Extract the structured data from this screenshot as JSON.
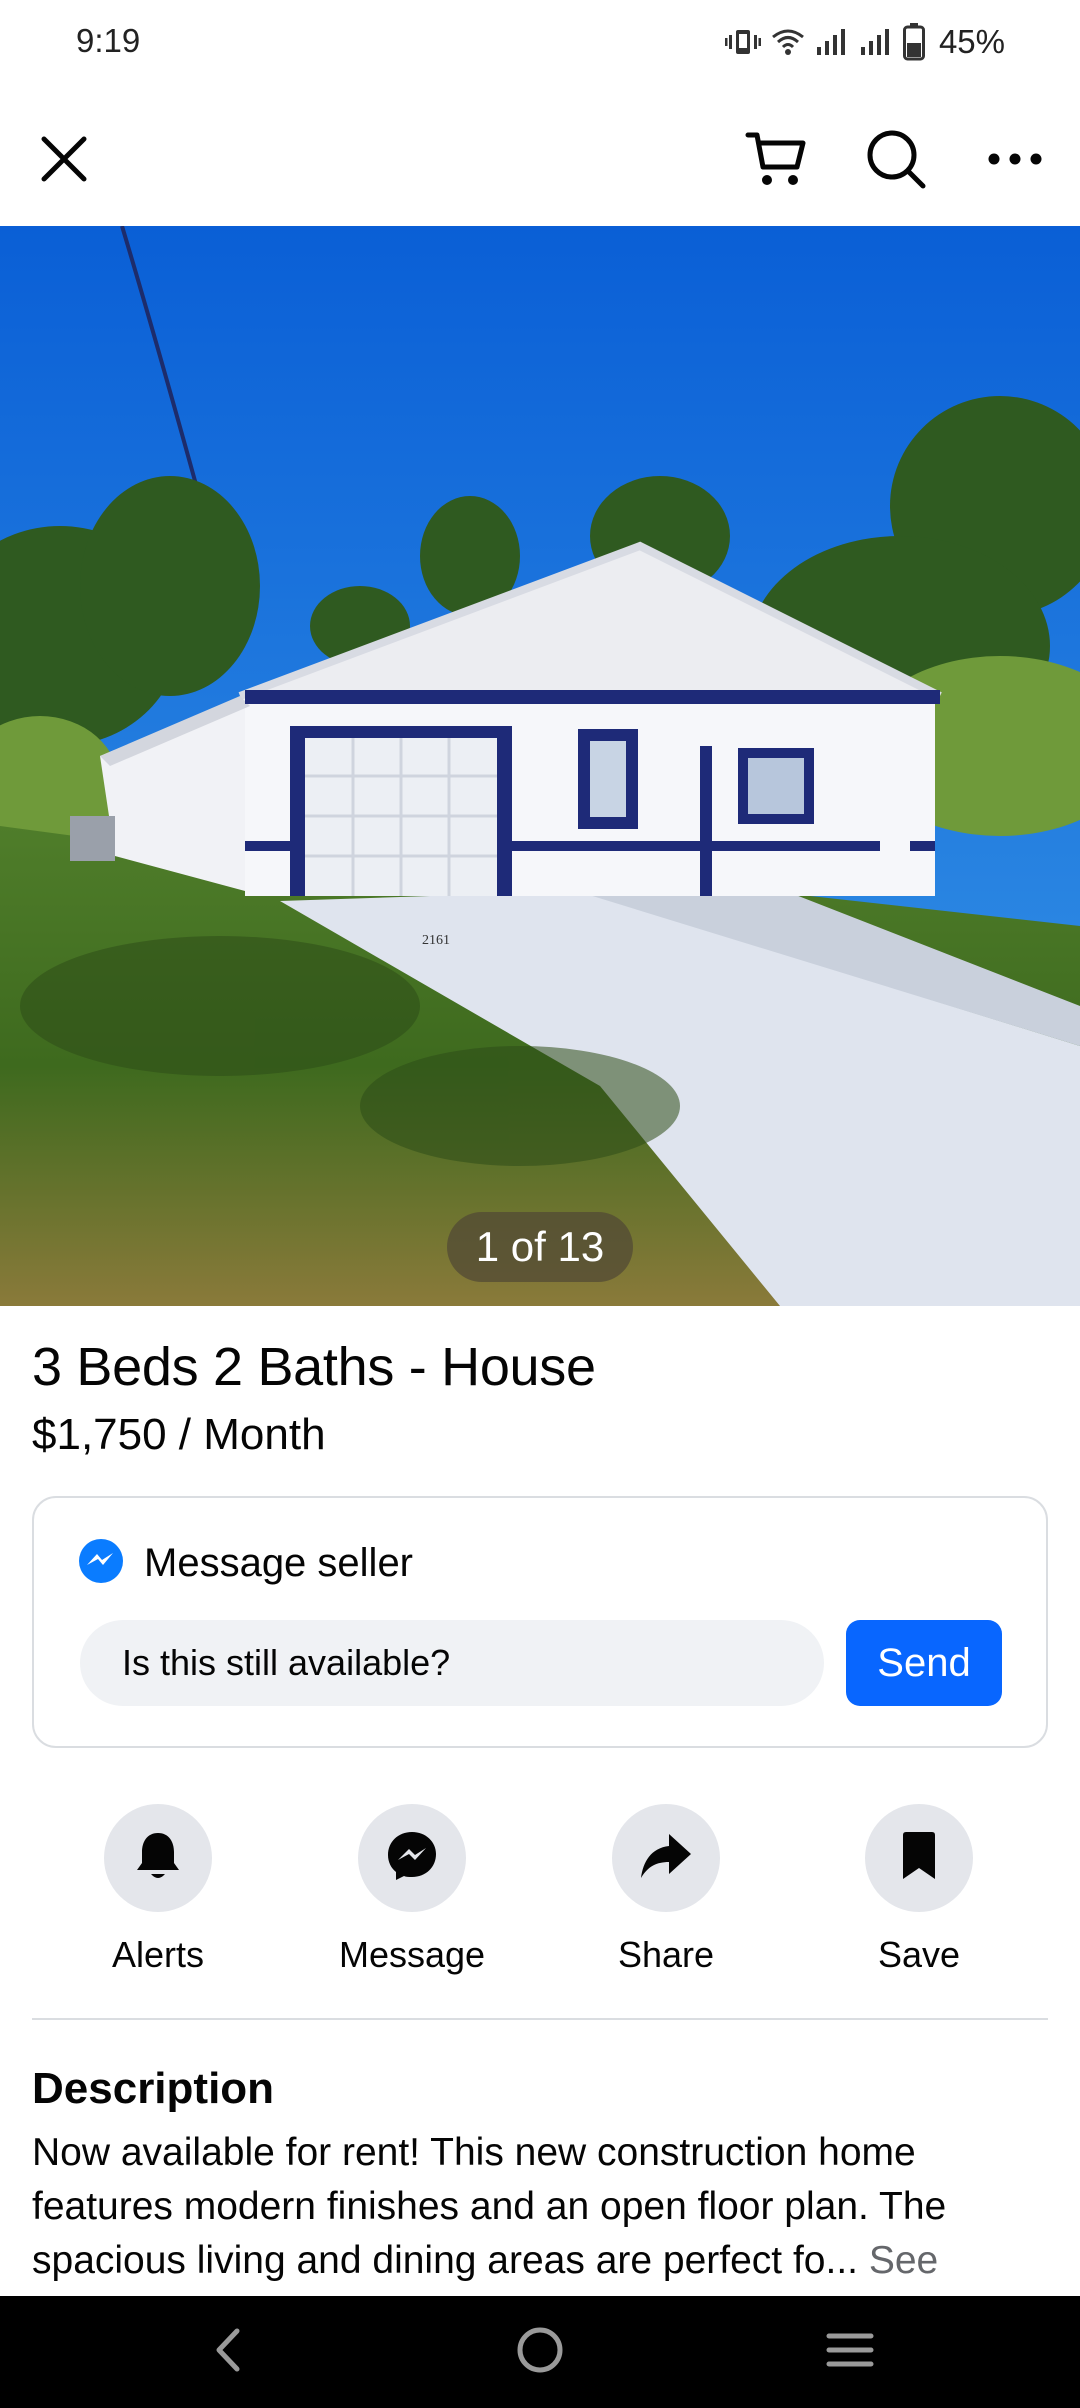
{
  "status_bar": {
    "time": "9:19",
    "battery": "45%",
    "icons": [
      "vibrate-icon",
      "wifi-icon",
      "signal-icon",
      "signal-icon",
      "battery-icon"
    ]
  },
  "top_bar": {
    "icons": [
      "close-icon",
      "cart-icon",
      "search-icon",
      "more-icon"
    ]
  },
  "photo": {
    "counter": "1 of 13",
    "house_number": "2161"
  },
  "listing": {
    "title": "3 Beds 2 Baths - House",
    "price": "$1,750 / Month"
  },
  "message_card": {
    "header": "Message seller",
    "input_value": "Is this still available?",
    "send_label": "Send"
  },
  "actions": [
    {
      "label": "Alerts",
      "icon": "bell-icon"
    },
    {
      "label": "Message",
      "icon": "messenger-icon"
    },
    {
      "label": "Share",
      "icon": "share-icon"
    },
    {
      "label": "Save",
      "icon": "bookmark-icon"
    }
  ],
  "description": {
    "heading": "Description",
    "text": "Now available for rent! This new construction home features modern finishes and an open floor plan. The spacious living and dining areas are perfect fo...",
    "see_more": "See"
  },
  "nav_bar": {
    "icons": [
      "back-icon",
      "home-icon",
      "recents-icon"
    ]
  },
  "colors": {
    "accent": "#0866ff",
    "chip_bg": "#f0f2f5",
    "circle_bg": "#e4e6eb",
    "border": "#dadde1",
    "muted_text": "#65676b"
  }
}
